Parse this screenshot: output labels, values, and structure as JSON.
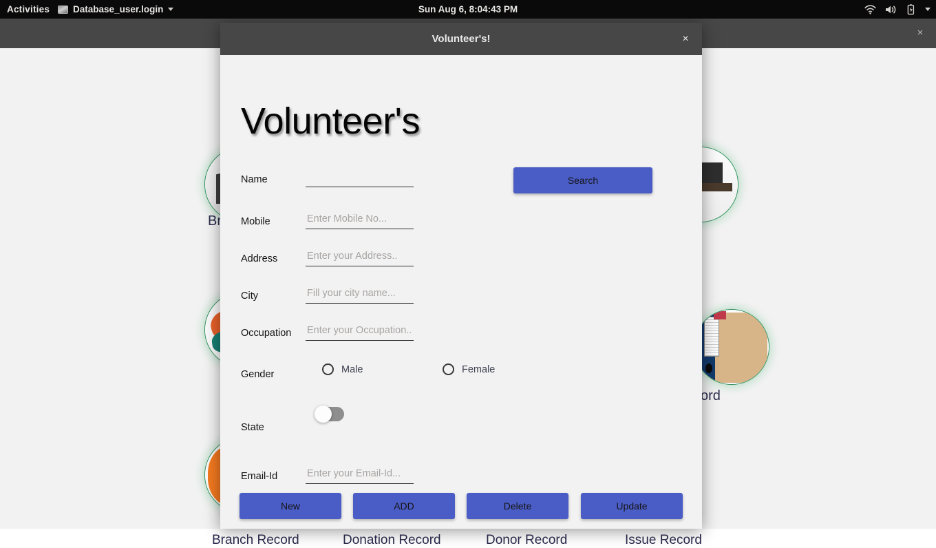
{
  "topbar": {
    "activities": "Activities",
    "app_name": "Database_user.login",
    "clock": "Sun Aug  6,  8:04:43 PM",
    "app_menu_caret_icon": "chevron-down-icon",
    "tray": {
      "wifi_icon": "wifi-icon",
      "volume_icon": "volume-icon",
      "battery_icon": "battery-charging-icon",
      "menu_icon": "chevron-down-icon"
    }
  },
  "background_window": {
    "close_label": "×",
    "captions": [
      {
        "text": "Br",
        "icon": "branch-record-icon"
      },
      {
        "text": "cord",
        "icon": "issue-record-icon"
      }
    ],
    "bottom_labels": [
      "Branch Record",
      "Donation Record",
      "Donor Record",
      "Issue Record"
    ]
  },
  "dialog": {
    "titlebar_title": "Volunteer's!",
    "close_label": "×",
    "heading": "Volunteer's",
    "fields": [
      {
        "label": "Name",
        "placeholder": "",
        "value": ""
      },
      {
        "label": "Mobile",
        "placeholder": "Enter Mobile No...",
        "value": ""
      },
      {
        "label": "Address",
        "placeholder": "Enter your Address..",
        "value": ""
      },
      {
        "label": "City",
        "placeholder": "Fill your city name...",
        "value": ""
      },
      {
        "label": "Occupation",
        "placeholder": "Enter your Occupation..",
        "value": ""
      },
      {
        "label": "Email-Id",
        "placeholder": "Enter your Email-Id...",
        "value": ""
      }
    ],
    "gender": {
      "label": "Gender",
      "options": [
        {
          "label": "Male",
          "selected": false
        },
        {
          "label": "Female",
          "selected": false
        }
      ]
    },
    "state": {
      "label": "State",
      "toggle_on": false
    },
    "search_button": "Search",
    "actions": [
      "New",
      "ADD",
      "Delete",
      "Update"
    ],
    "colors": {
      "button_blue": "#4a5cc5",
      "dialog_bg": "#f2f2f2",
      "titlebar": "#474747",
      "toggle_track": "#8e8e8e"
    }
  }
}
